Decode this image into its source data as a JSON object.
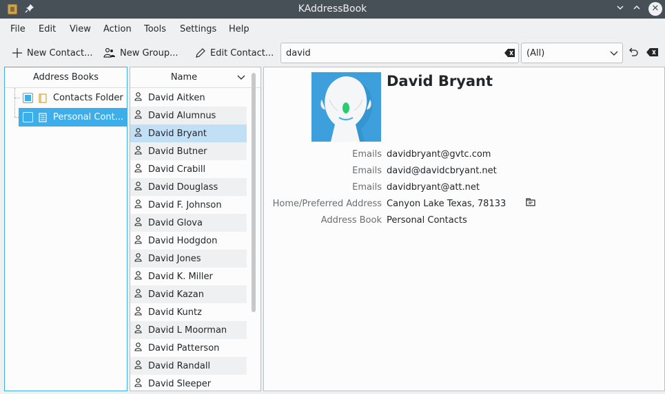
{
  "window": {
    "title": "KAddressBook"
  },
  "menu": [
    "File",
    "Edit",
    "View",
    "Action",
    "Tools",
    "Settings",
    "Help"
  ],
  "toolbar": {
    "new_contact": "New Contact...",
    "new_group": "New Group...",
    "edit_contact": "Edit Contact...",
    "search_value": "david",
    "filter_value": "(All)"
  },
  "address_books": {
    "header": "Address Books",
    "items": [
      {
        "label": "Contacts Folder",
        "checked": "partial"
      },
      {
        "label": "Personal Cont...",
        "checked": "unchecked"
      }
    ]
  },
  "contacts": {
    "header": "Name",
    "items": [
      "David Aitken",
      "David Alumnus",
      "David Bryant",
      "David Butner",
      "David Crabill",
      "David Douglass",
      "David F. Johnson",
      "David Glova",
      "David Hodgdon",
      "David Jones",
      "David K. Miller",
      "David Kazan",
      "David Kuntz",
      "David L Moorman",
      "David Patterson",
      "David Randall",
      "David Sleeper"
    ],
    "selected": "David Bryant"
  },
  "detail": {
    "name": "David Bryant",
    "fields": [
      {
        "label": "Emails",
        "value": "davidbryant@gvtc.com"
      },
      {
        "label": "Emails",
        "value": "david@davidcbryant.net"
      },
      {
        "label": "Emails",
        "value": "davidbryant@att.net"
      },
      {
        "label": "Home/Preferred Address",
        "value": "Canyon Lake Texas, 78133"
      },
      {
        "label": "Address Book",
        "value": "Personal Contacts"
      }
    ]
  },
  "colors": {
    "accent": "#3daee9",
    "titlebar": "#475057",
    "selection_light": "#c2e0f5"
  }
}
